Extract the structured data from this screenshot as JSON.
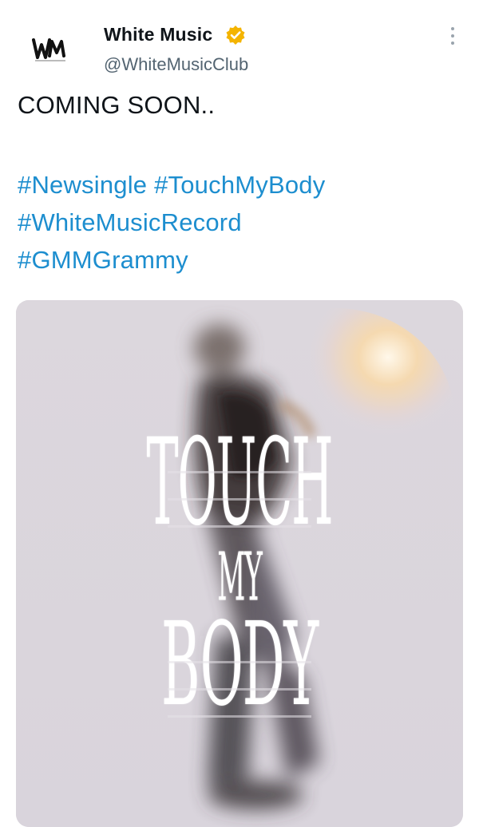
{
  "account": {
    "display_name": "White Music",
    "handle": "@WhiteMusicClub",
    "avatar_logo_text": "WM",
    "verified_badge_color": "#f4b400"
  },
  "tweet": {
    "text": "COMING SOON..",
    "hashtags": [
      "#Newsingle",
      "#TouchMyBody",
      "#WhiteMusicRecord",
      "#GMMGrammy"
    ],
    "hashtag_color": "#1d8ecf"
  },
  "media": {
    "poster_lines": [
      "TOUCH",
      "MY",
      "BODY"
    ]
  },
  "icons": {
    "more": "more-vertical-icon",
    "verified": "verified-badge-icon"
  }
}
